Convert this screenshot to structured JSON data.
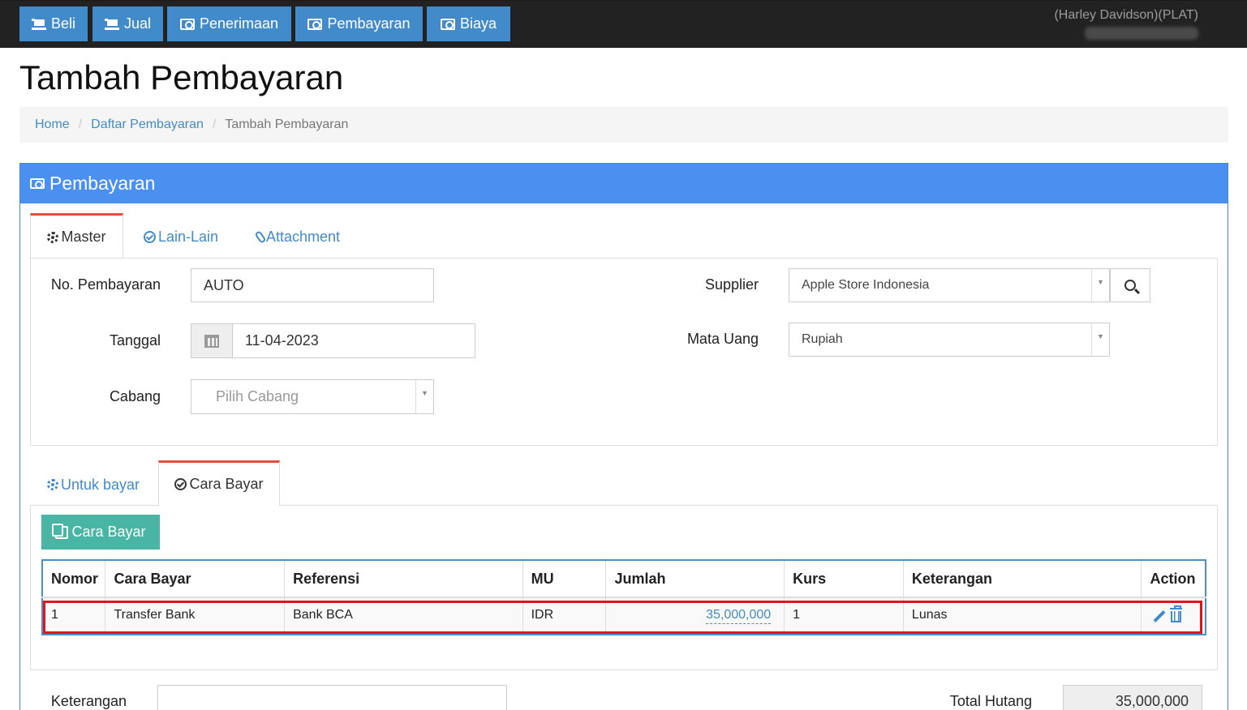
{
  "navbar": {
    "buttons": [
      {
        "label": "Beli",
        "icon": "cart-icon"
      },
      {
        "label": "Jual",
        "icon": "cart-icon"
      },
      {
        "label": "Penerimaan",
        "icon": "money-icon"
      },
      {
        "label": "Pembayaran",
        "icon": "money-icon"
      },
      {
        "label": "Biaya",
        "icon": "money-icon"
      }
    ],
    "user_company": "(Harley Davidson)(PLAT)"
  },
  "page": {
    "title": "Tambah Pembayaran"
  },
  "breadcrumb": {
    "home": "Home",
    "list": "Daftar Pembayaran",
    "current": "Tambah Pembayaran"
  },
  "panel": {
    "title": "Pembayaran"
  },
  "top_tabs": {
    "master": "Master",
    "lain": "Lain-Lain",
    "attachment": "Attachment"
  },
  "form": {
    "no_pembayaran_label": "No. Pembayaran",
    "no_pembayaran_value": "AUTO",
    "tanggal_label": "Tanggal",
    "tanggal_value": "11-04-2023",
    "cabang_label": "Cabang",
    "cabang_placeholder": "Pilih Cabang",
    "supplier_label": "Supplier",
    "supplier_value": "Apple Store Indonesia",
    "mata_uang_label": "Mata Uang",
    "mata_uang_value": "Rupiah"
  },
  "bottom_tabs": {
    "untuk_bayar": "Untuk bayar",
    "cara_bayar": "Cara Bayar"
  },
  "add_button": "Cara Bayar",
  "table": {
    "headers": [
      "Nomor",
      "Cara Bayar",
      "Referensi",
      "MU",
      "Jumlah",
      "Kurs",
      "Keterangan",
      "Action"
    ],
    "rows": [
      {
        "nomor": "1",
        "cara_bayar": "Transfer Bank",
        "referensi": "Bank BCA",
        "mu": "IDR",
        "jumlah": "35,000,000",
        "kurs": "1",
        "keterangan": "Lunas"
      }
    ]
  },
  "footer": {
    "keterangan_label": "Keterangan",
    "total_hutang_label": "Total Hutang",
    "total_hutang_value": "35,000,000"
  },
  "colors": {
    "navbar": "#222222",
    "primary": "#428bca",
    "panel_header": "#4a90f0",
    "green": "#48b5a5",
    "highlight": "#e0141e",
    "tab_active": "#e74c3c"
  }
}
